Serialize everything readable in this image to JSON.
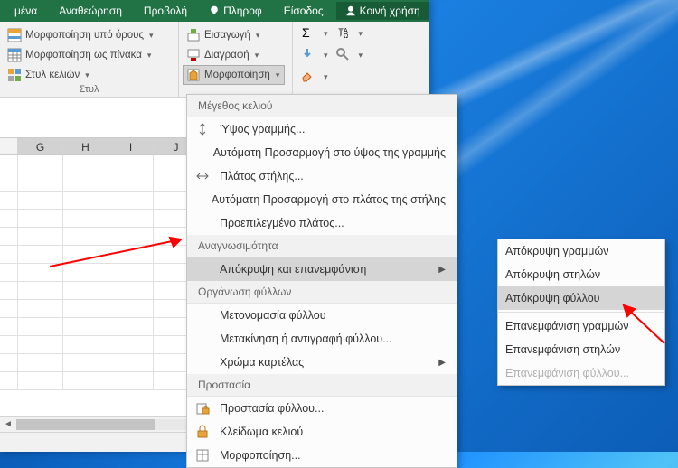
{
  "tabs": {
    "t1": "μένα",
    "t2": "Αναθεώρηση",
    "t3": "Προβολή",
    "info": "Πληροφ",
    "signin": "Είσοδος",
    "share": "Κοινή χρήση"
  },
  "ribbon": {
    "styles": {
      "cond": "Μορφοποίηση υπό όρους",
      "astable": "Μορφοποίηση ως πίνακα",
      "cellstyles": "Στυλ κελιών",
      "label": "Στυλ"
    },
    "cells": {
      "insert": "Εισαγωγή",
      "delete": "Διαγραφή",
      "format": "Μορφοποίηση"
    }
  },
  "cols": [
    "",
    "G",
    "H",
    "I",
    "J"
  ],
  "menu1": {
    "hdr_size": "Μέγεθος κελιού",
    "row_height": "Ύψος γραμμής...",
    "autofit_row": "Αυτόματη Προσαρμογή στο ύψος της γραμμής",
    "col_width": "Πλάτος στήλης...",
    "autofit_col": "Αυτόματη Προσαρμογή στο πλάτος της στήλης",
    "default_width": "Προεπιλεγμένο πλάτος...",
    "hdr_vis": "Αναγνωσιμότητα",
    "hide_unhide": "Απόκρυψη και επανεμφάνιση",
    "hdr_org": "Οργάνωση φύλλων",
    "rename": "Μετονομασία φύλλου",
    "move_copy": "Μετακίνηση ή αντιγραφή φύλλου...",
    "tab_color": "Χρώμα καρτέλας",
    "hdr_prot": "Προστασία",
    "protect_sheet": "Προστασία φύλλου...",
    "lock_cell": "Κλείδωμα κελιού",
    "format_cells": "Μορφοποίηση...",
    "u": {
      "row_height": "Ύ",
      "col_width": "Π",
      "rename": "Μ",
      "tab_color": "Χ",
      "protect": "Π",
      "lock": "Κ",
      "hide": "Α"
    }
  },
  "menu2": {
    "hide_rows": "Απόκρυψη γραμμών",
    "hide_cols": "Απόκρυψη στηλών",
    "hide_sheet": "Απόκρυψη φύλλου",
    "unhide_rows": "Επανεμφάνιση γραμμών",
    "unhide_cols": "Επανεμφάνιση στηλών",
    "unhide_sheet": "Επανεμφάνιση φύλλου..."
  }
}
